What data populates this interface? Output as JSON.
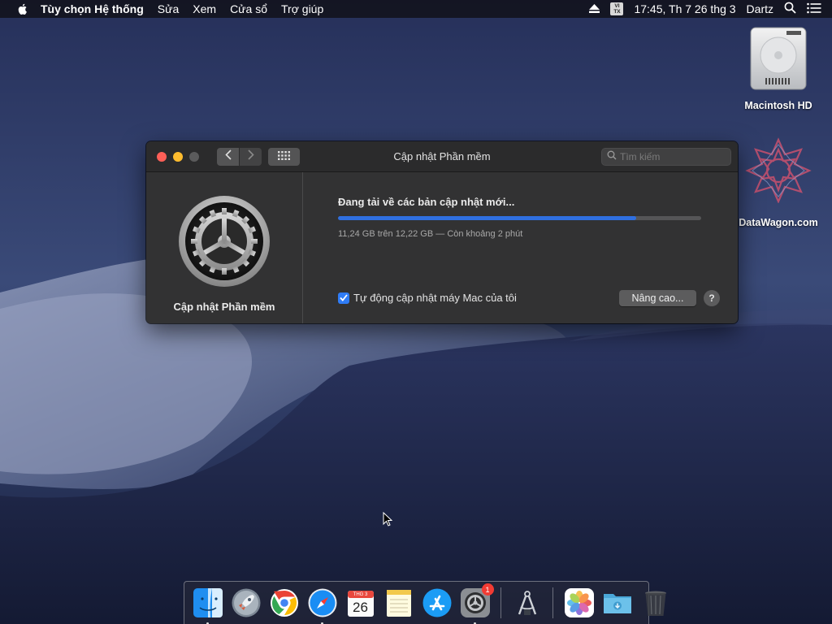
{
  "menubar": {
    "apple_icon": "apple-logo-icon",
    "app_name": "Tùy chọn Hệ thống",
    "menus": [
      "Sửa",
      "Xem",
      "Cửa sổ",
      "Trợ giúp"
    ],
    "input_badge_top": "VI",
    "input_badge_bottom": "TX",
    "clock": "17:45, Th 7 26 thg 3",
    "user": "Dartz"
  },
  "desktop": {
    "icons": [
      {
        "label": "Macintosh HD",
        "icon": "hard-drive-icon"
      },
      {
        "label": "DataWagon.com",
        "icon": "datawagon-logo-icon"
      }
    ]
  },
  "window": {
    "title": "Cập nhật Phần mềm",
    "search_placeholder": "Tìm kiếm",
    "sidebar_name": "Cập nhật Phần mềm",
    "status": "Đang tải về các bản cập nhật mới...",
    "progress": 0.82,
    "detail": "11,24 GB trên 12,22 GB — Còn khoảng 2 phút",
    "auto_update_label": "Tự động cập nhật máy Mac của tôi",
    "auto_update_checked": true,
    "advanced_button": "Nâng cao...",
    "help_button": "?"
  },
  "dock": {
    "calendar_month": "THG 3",
    "calendar_day": "26",
    "settings_badge": "1",
    "items": [
      "finder",
      "launchpad",
      "chrome",
      "safari",
      "calendar",
      "notes",
      "app-store",
      "system-preferences",
      "utility",
      "photos",
      "downloads-folder",
      "trash"
    ]
  },
  "colors": {
    "progress_fill": "#2f6fe0",
    "checkbox": "#2f7cf6",
    "close": "#fe5f57",
    "minimize": "#febc2e"
  }
}
